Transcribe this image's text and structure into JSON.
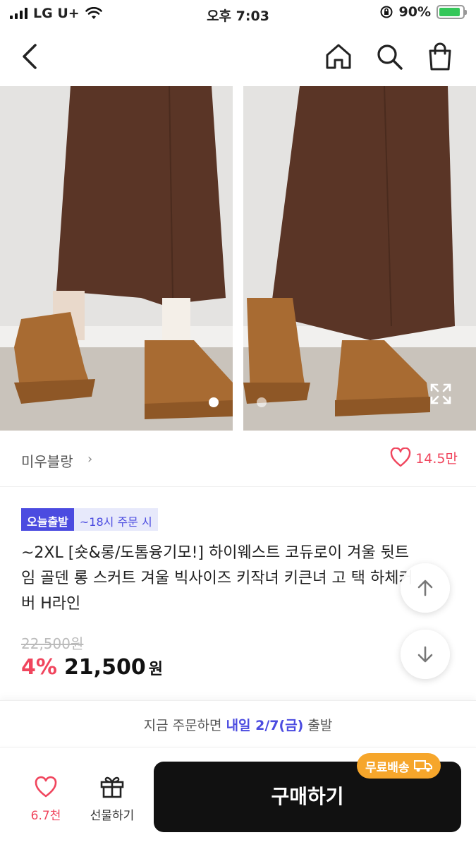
{
  "status_bar": {
    "carrier": "LG U+",
    "time": "오후 7:03",
    "battery": "90%",
    "battery_level": 0.9
  },
  "nav": {
    "back_icon": "chevron-left-icon",
    "home_icon": "home-icon",
    "search_icon": "search-icon",
    "bag_icon": "shopping-bag-icon"
  },
  "gallery": {
    "photo_count": 2,
    "current_index": 0,
    "expand_icon": "expand-icon"
  },
  "brand": {
    "name": "미우블랑",
    "like_count": "14.5만"
  },
  "badges": {
    "main": "오늘출발",
    "sub": "~18시 주문 시"
  },
  "product": {
    "title": "~2XL [숏&롱/도톰융기모!] 하이웨스트 코듀로이 겨울 뒷트임 골덴 롱 스커트 겨울 빅사이즈 키작녀 키큰녀 고 택 하체커버 H라인",
    "original_price": "22,500원",
    "discount": "4%",
    "price": "21,500",
    "currency": "원"
  },
  "shipping": {
    "prefix": "지금 주문하면",
    "highlight": "내일 2/7(금)",
    "suffix": "출발"
  },
  "bottom_bar": {
    "like_count": "6.7천",
    "gift_label": "선물하기",
    "buy_label": "구매하기",
    "free_shipping": "무료배송"
  },
  "colors": {
    "accent": "#4b4be0",
    "pink": "#f0455d",
    "orange": "#f6a62b"
  }
}
